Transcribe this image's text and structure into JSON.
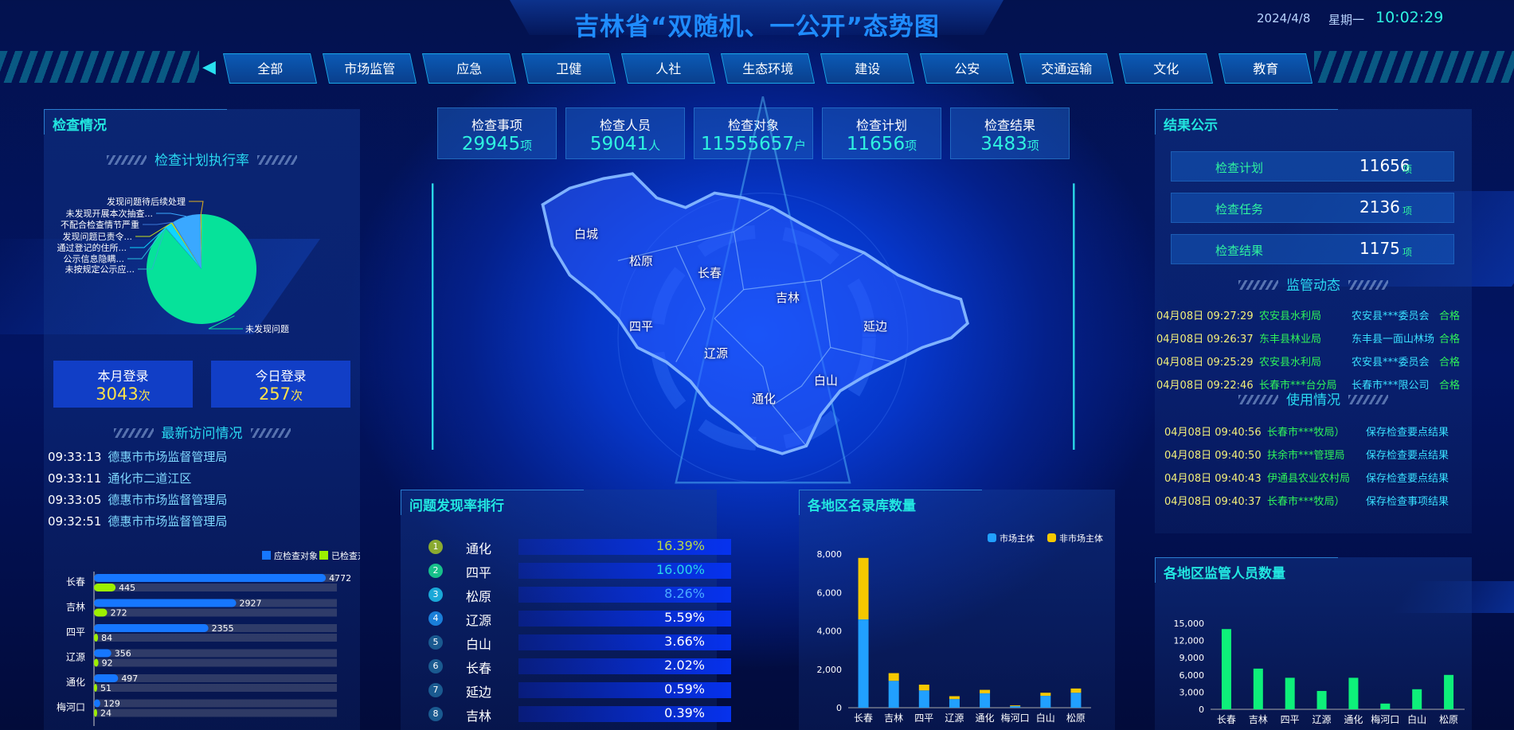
{
  "header": {
    "title": "吉林省“双随机、一公开”态势图",
    "date": "2024/4/8",
    "weekday": "星期一",
    "time": "10:02:29"
  },
  "nav": {
    "tabs": [
      "全部",
      "市场监管",
      "应急",
      "卫健",
      "人社",
      "生态环境",
      "建设",
      "公安",
      "交通运输",
      "文化",
      "教育"
    ],
    "active": "全部"
  },
  "stats": [
    {
      "label": "检查事项",
      "value": "29945",
      "unit": "项"
    },
    {
      "label": "检查人员",
      "value": "59041",
      "unit": "人"
    },
    {
      "label": "检查对象",
      "value": "11555657",
      "unit": "户"
    },
    {
      "label": "检查计划",
      "value": "11656",
      "unit": "项"
    },
    {
      "label": "检查结果",
      "value": "3483",
      "unit": "项"
    }
  ],
  "left": {
    "title": "检查情况",
    "pie_title": "检查计划执行率",
    "logins": [
      {
        "label": "本月登录",
        "value": "3043",
        "unit": "次"
      },
      {
        "label": "今日登录",
        "value": "257",
        "unit": "次"
      }
    ],
    "visits_title": "最新访问情况",
    "visits": [
      {
        "time": "09:33:13",
        "org": "德惠市市场监督管理局"
      },
      {
        "time": "09:33:11",
        "org": "通化市二道江区"
      },
      {
        "time": "09:33:05",
        "org": "德惠市市场监督管理局"
      },
      {
        "time": "09:32:51",
        "org": "德惠市市场监督管理局"
      }
    ]
  },
  "map": {
    "regions": [
      "白城",
      "松原",
      "长春",
      "吉林",
      "四平",
      "辽源",
      "延边",
      "白山",
      "通化"
    ]
  },
  "ranking": {
    "title": "问题发现率排行",
    "rows": [
      {
        "rank": "1",
        "city": "通化",
        "rate": "16.39%"
      },
      {
        "rank": "2",
        "city": "四平",
        "rate": "16.00%"
      },
      {
        "rank": "3",
        "city": "松原",
        "rate": "8.26%"
      },
      {
        "rank": "4",
        "city": "辽源",
        "rate": "5.59%"
      },
      {
        "rank": "5",
        "city": "白山",
        "rate": "3.66%"
      },
      {
        "rank": "6",
        "city": "长春",
        "rate": "2.02%"
      },
      {
        "rank": "7",
        "city": "延边",
        "rate": "0.59%"
      },
      {
        "rank": "8",
        "city": "吉林",
        "rate": "0.39%"
      }
    ]
  },
  "directory": {
    "title": "各地区名录库数量"
  },
  "right": {
    "title": "结果公示",
    "summary": [
      {
        "label": "检查计划",
        "value": "11656",
        "unit": "项"
      },
      {
        "label": "检查任务",
        "value": "2136",
        "unit": "项"
      },
      {
        "label": "检查结果",
        "value": "1175",
        "unit": "项"
      }
    ],
    "dynamics_title": "监管动态",
    "dynamics": [
      {
        "time": "04月08日 09:27:29",
        "dept": "农安县水利局",
        "target": "农安县***委员会",
        "result": "合格"
      },
      {
        "time": "04月08日 09:26:37",
        "dept": "东丰县林业局",
        "target": "东丰县一面山林场",
        "result": "合格"
      },
      {
        "time": "04月08日 09:25:29",
        "dept": "农安县水利局",
        "target": "农安县***委员会",
        "result": "合格"
      },
      {
        "time": "04月08日 09:22:46",
        "dept": "长春市***台分局",
        "target": "长春市***限公司",
        "result": "合格"
      }
    ],
    "usage_title": "使用情况",
    "usage": [
      {
        "time": "04月08日 09:40:56",
        "org": "长春市***牧局）",
        "action": "保存检查要点结果"
      },
      {
        "time": "04月08日 09:40:50",
        "org": "扶余市***管理局",
        "action": "保存检查要点结果"
      },
      {
        "time": "04月08日 09:40:43",
        "org": "伊通县农业农村局",
        "action": "保存检查要点结果"
      },
      {
        "time": "04月08日 09:40:37",
        "org": "长春市***牧局）",
        "action": "保存检查事项结果"
      }
    ]
  },
  "staff": {
    "title": "各地区监管人员数量"
  },
  "colors": {
    "accent": "#22e6e0",
    "title": "#1f8cff",
    "blue": "#1677ff",
    "green": "#9cf000",
    "market": "#21a0ff",
    "nonmarket": "#f5c800",
    "staff": "#0ef07a"
  },
  "chart_data": [
    {
      "type": "pie",
      "title": "检查计划执行率",
      "slices": [
        {
          "name": "未发现问题",
          "value": 88.5,
          "color": "#06e29a"
        },
        {
          "name": "未按规定公示应...",
          "value": 0.1,
          "color": "#2ab8c8"
        },
        {
          "name": "公示信息隐瞒...",
          "value": 0.1,
          "color": "#29c0e0"
        },
        {
          "name": "通过登记的住所...",
          "value": 2.0,
          "color": "#0fd5ff"
        },
        {
          "name": "发现问题已责令...",
          "value": 0.4,
          "color": "#c8e020"
        },
        {
          "name": "不配合检查情节严重",
          "value": 0.2,
          "color": "#3a78d8"
        },
        {
          "name": "未发现开展本次抽查...",
          "value": 8.4,
          "color": "#3aa8ff"
        },
        {
          "name": "发现问题待后续处理",
          "value": 0.3,
          "color": "#e0b020"
        }
      ]
    },
    {
      "type": "bar",
      "orientation": "horizontal",
      "categories": [
        "长春",
        "吉林",
        "四平",
        "辽源",
        "通化",
        "梅河口"
      ],
      "xlim": [
        0,
        5000
      ],
      "series": [
        {
          "name": "应检查对象",
          "values": [
            4772,
            2927,
            2355,
            356,
            497,
            129
          ]
        },
        {
          "name": "已检查对象",
          "values": [
            445,
            272,
            84,
            92,
            51,
            24
          ]
        }
      ]
    },
    {
      "type": "bar",
      "stacked": true,
      "title": "各地区名录库数量",
      "categories": [
        "长春",
        "吉林",
        "四平",
        "辽源",
        "通化",
        "梅河口",
        "白山",
        "松原"
      ],
      "ylim": [
        0,
        8000
      ],
      "yticks": [
        "0",
        "2,000",
        "4,000",
        "6,000",
        "8,000"
      ],
      "legend": "top-right",
      "series": [
        {
          "name": "市场主体",
          "values": [
            4600,
            1400,
            900,
            450,
            750,
            80,
            620,
            780
          ]
        },
        {
          "name": "非市场主体",
          "values": [
            3200,
            400,
            300,
            150,
            180,
            40,
            160,
            220
          ]
        }
      ]
    },
    {
      "type": "bar",
      "title": "各地区监管人员数量",
      "categories": [
        "长春",
        "吉林",
        "四平",
        "辽源",
        "通化",
        "梅河口",
        "白山",
        "松原"
      ],
      "ylim": [
        0,
        15000
      ],
      "yticks": [
        "0",
        "3,000",
        "6,000",
        "9,000",
        "12,000",
        "15,000"
      ],
      "values": [
        14000,
        7100,
        5500,
        3200,
        5500,
        1000,
        3500,
        6000
      ]
    }
  ]
}
